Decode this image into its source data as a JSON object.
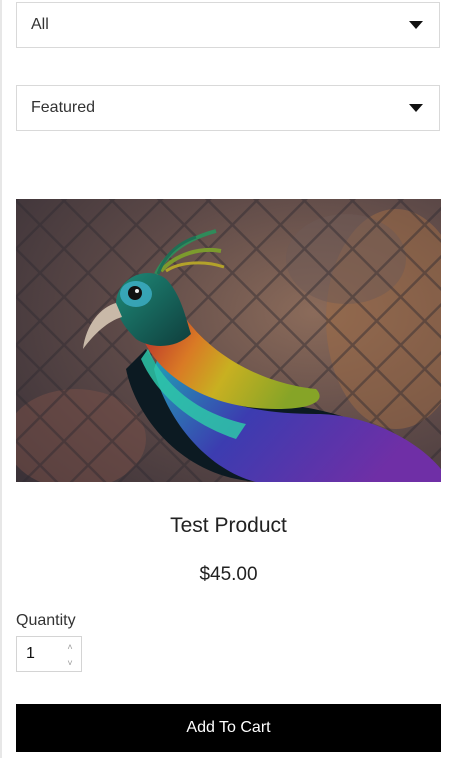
{
  "filters": {
    "category": {
      "selected": "All",
      "icon": "caret-down-icon"
    },
    "sort": {
      "selected": "Featured",
      "icon": "caret-down-icon"
    }
  },
  "product": {
    "image_alt": "Colorful pheasant bird",
    "title": "Test Product",
    "price": "$45.00",
    "quantity_label": "Quantity",
    "quantity_value": "1",
    "add_to_cart_label": "Add To Cart"
  },
  "colors": {
    "button_bg": "#000000",
    "button_text": "#ffffff",
    "border": "#d9d9d9"
  }
}
